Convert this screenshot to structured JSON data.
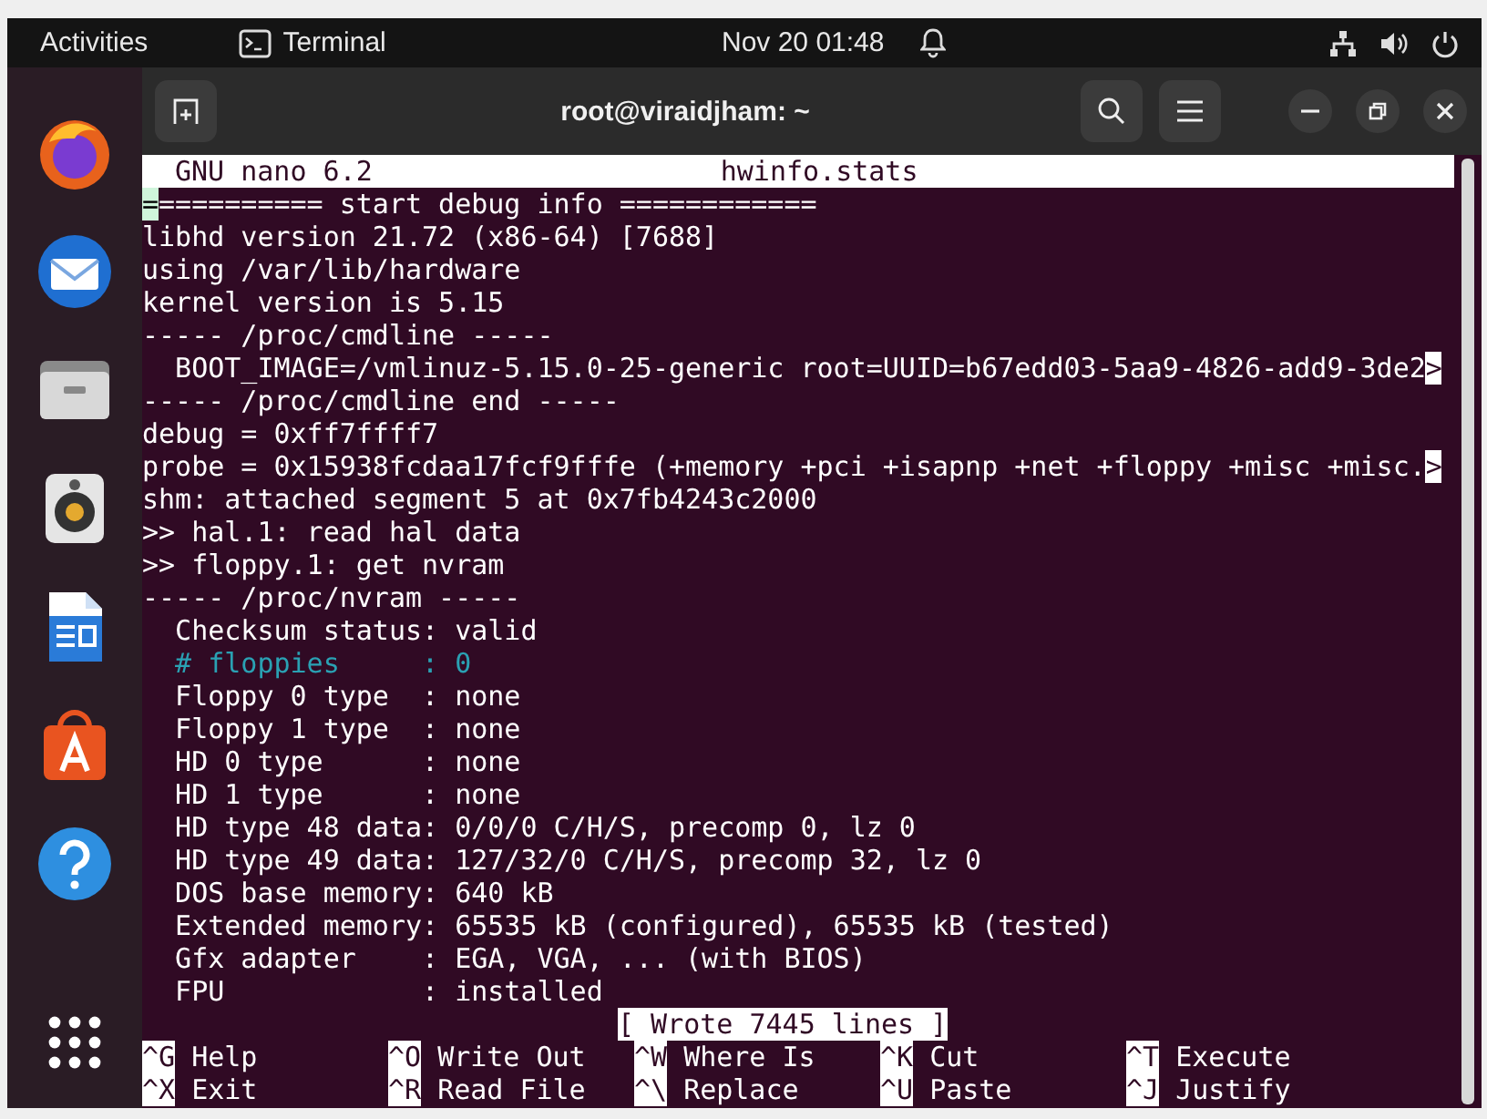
{
  "top_bar": {
    "activities": "Activities",
    "app_name": "Terminal",
    "clock": "Nov 20  01:48"
  },
  "dock": {
    "items": [
      {
        "kind": "browser",
        "selected": false
      },
      {
        "kind": "mail",
        "selected": false
      },
      {
        "kind": "folder",
        "selected": false
      },
      {
        "kind": "speaker",
        "selected": false
      },
      {
        "kind": "document",
        "selected": false
      },
      {
        "kind": "store",
        "selected": false
      },
      {
        "kind": "help",
        "selected": false
      },
      {
        "kind": "grid",
        "selected": false
      }
    ]
  },
  "window": {
    "title": "root@viraidjham: ~"
  },
  "nano": {
    "version": "GNU nano 6.2",
    "filename": "hwinfo.stats",
    "lines": [
      {
        "text": "=========== start debug info ============",
        "kind": "normal",
        "cursor": true
      },
      {
        "text": "libhd version 21.72 (x86-64) [7688]",
        "kind": "normal",
        "cursor": false
      },
      {
        "text": "using /var/lib/hardware",
        "kind": "normal",
        "cursor": false
      },
      {
        "text": "kernel version is 5.15",
        "kind": "normal",
        "cursor": false
      },
      {
        "text": "----- /proc/cmdline -----",
        "kind": "normal",
        "cursor": false
      },
      {
        "text": "  BOOT_IMAGE=/vmlinuz-5.15.0-25-generic root=UUID=b67edd03-5aa9-4826-add9-3de2",
        "kind": "normal",
        "cursor": false,
        "overflow": ">"
      },
      {
        "text": "----- /proc/cmdline end -----",
        "kind": "normal",
        "cursor": false
      },
      {
        "text": "debug = 0xff7ffff7",
        "kind": "normal",
        "cursor": false
      },
      {
        "text": "probe = 0x15938fcdaa17fcf9fffe (+memory +pci +isapnp +net +floppy +misc +misc.",
        "kind": "normal",
        "cursor": false,
        "overflow": ">"
      },
      {
        "text": "shm: attached segment 5 at 0x7fb4243c2000",
        "kind": "normal",
        "cursor": false
      },
      {
        "text": ">> hal.1: read hal data",
        "kind": "normal",
        "cursor": false
      },
      {
        "text": ">> floppy.1: get nvram",
        "kind": "normal",
        "cursor": false
      },
      {
        "text": "----- /proc/nvram -----",
        "kind": "normal",
        "cursor": false
      },
      {
        "text": "  Checksum status: valid",
        "kind": "normal",
        "cursor": false
      },
      {
        "text": "  # floppies     : 0",
        "kind": "comment",
        "cursor": false
      },
      {
        "text": "  Floppy 0 type  : none",
        "kind": "normal",
        "cursor": false
      },
      {
        "text": "  Floppy 1 type  : none",
        "kind": "normal",
        "cursor": false
      },
      {
        "text": "  HD 0 type      : none",
        "kind": "normal",
        "cursor": false
      },
      {
        "text": "  HD 1 type      : none",
        "kind": "normal",
        "cursor": false
      },
      {
        "text": "  HD type 48 data: 0/0/0 C/H/S, precomp 0, lz 0",
        "kind": "normal",
        "cursor": false
      },
      {
        "text": "  HD type 49 data: 127/32/0 C/H/S, precomp 32, lz 0",
        "kind": "normal",
        "cursor": false
      },
      {
        "text": "  DOS base memory: 640 kB",
        "kind": "normal",
        "cursor": false
      },
      {
        "text": "  Extended memory: 65535 kB (configured), 65535 kB (tested)",
        "kind": "normal",
        "cursor": false
      },
      {
        "text": "  Gfx adapter    : EGA, VGA, ... (with BIOS)",
        "kind": "normal",
        "cursor": false
      },
      {
        "text": "  FPU            : installed",
        "kind": "normal",
        "cursor": false
      }
    ],
    "status": "[ Wrote 7445 lines ]",
    "shortcuts": [
      {
        "key": "^G",
        "label": "Help"
      },
      {
        "key": "^O",
        "label": "Write Out"
      },
      {
        "key": "^W",
        "label": "Where Is"
      },
      {
        "key": "^K",
        "label": "Cut"
      },
      {
        "key": "^T",
        "label": "Execute"
      },
      {
        "key": "^X",
        "label": "Exit"
      },
      {
        "key": "^R",
        "label": "Read File"
      },
      {
        "key": "^\\",
        "label": "Replace"
      },
      {
        "key": "^U",
        "label": "Paste"
      },
      {
        "key": "^J",
        "label": "Justify"
      }
    ]
  }
}
